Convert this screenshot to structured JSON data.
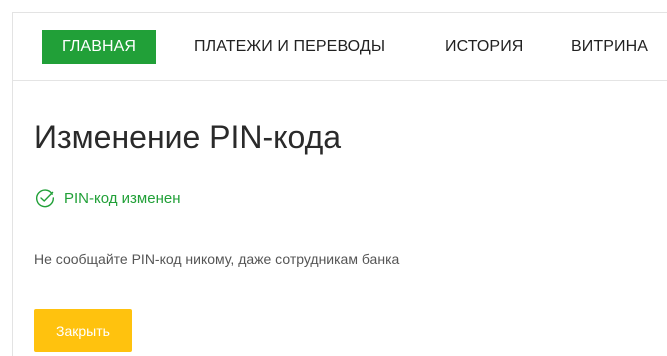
{
  "nav": {
    "items": [
      {
        "label": "ГЛАВНАЯ",
        "active": true
      },
      {
        "label": "ПЛАТЕЖИ И ПЕРЕВОДЫ",
        "active": false
      },
      {
        "label": "ИСТОРИЯ",
        "active": false
      },
      {
        "label": "ВИТРИНА",
        "active": false
      }
    ]
  },
  "page": {
    "title": "Изменение PIN-кода",
    "status": {
      "icon": "check-circle-icon",
      "text": "PIN-код изменен"
    },
    "warning": "Не сообщайте PIN-код никому, даже сотрудникам банка",
    "close_label": "Закрыть"
  },
  "colors": {
    "brand_green": "#21a038",
    "button_yellow": "#ffc20e",
    "text_dark": "#2a2a2a",
    "text_muted": "#555555"
  }
}
